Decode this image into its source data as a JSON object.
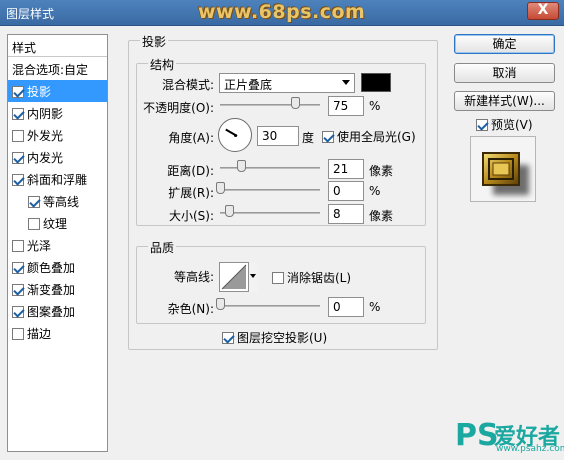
{
  "window": {
    "title": "图层样式",
    "watermark": "www.68ps.com",
    "close": "X"
  },
  "style_list": {
    "header": "样式",
    "blend_options": "混合选项:自定",
    "items": [
      {
        "label": "投影",
        "checked": true,
        "selected": true
      },
      {
        "label": "内阴影",
        "checked": true
      },
      {
        "label": "外发光",
        "checked": false
      },
      {
        "label": "内发光",
        "checked": true
      },
      {
        "label": "斜面和浮雕",
        "checked": true
      },
      {
        "label": "等高线",
        "checked": true,
        "sub": true
      },
      {
        "label": "纹理",
        "checked": false,
        "sub": true
      },
      {
        "label": "光泽",
        "checked": false
      },
      {
        "label": "颜色叠加",
        "checked": true
      },
      {
        "label": "渐变叠加",
        "checked": true
      },
      {
        "label": "图案叠加",
        "checked": true
      },
      {
        "label": "描边",
        "checked": false
      }
    ]
  },
  "drop_shadow": {
    "title": "投影",
    "structure": {
      "title": "结构",
      "blend_mode_label": "混合模式:",
      "blend_mode_value": "正片叠底",
      "color": "#000000",
      "opacity_label": "不透明度(O):",
      "opacity_value": "75",
      "opacity_unit": "%",
      "angle_label": "角度(A):",
      "angle_value": "30",
      "angle_unit": "度",
      "global_light_label": "使用全局光(G)",
      "global_light_checked": true,
      "distance_label": "距离(D):",
      "distance_value": "21",
      "distance_unit": "像素",
      "spread_label": "扩展(R):",
      "spread_value": "0",
      "spread_unit": "%",
      "size_label": "大小(S):",
      "size_value": "8",
      "size_unit": "像素"
    },
    "quality": {
      "title": "品质",
      "contour_label": "等高线:",
      "anti_alias_label": "消除锯齿(L)",
      "anti_alias_checked": false,
      "noise_label": "杂色(N):",
      "noise_value": "0",
      "noise_unit": "%"
    },
    "knockout_label": "图层挖空投影(U)",
    "knockout_checked": true
  },
  "buttons": {
    "ok": "确定",
    "cancel": "取消",
    "new_style": "新建样式(W)...",
    "preview_label": "预览(V)",
    "preview_checked": true
  },
  "logo": {
    "ps": "PS",
    "name": "爱好者",
    "url": "www.psahz.com"
  },
  "colors": {
    "title_bar": "#3a6aa3",
    "selection": "#3399ff",
    "logo": "#1aa8a0"
  }
}
